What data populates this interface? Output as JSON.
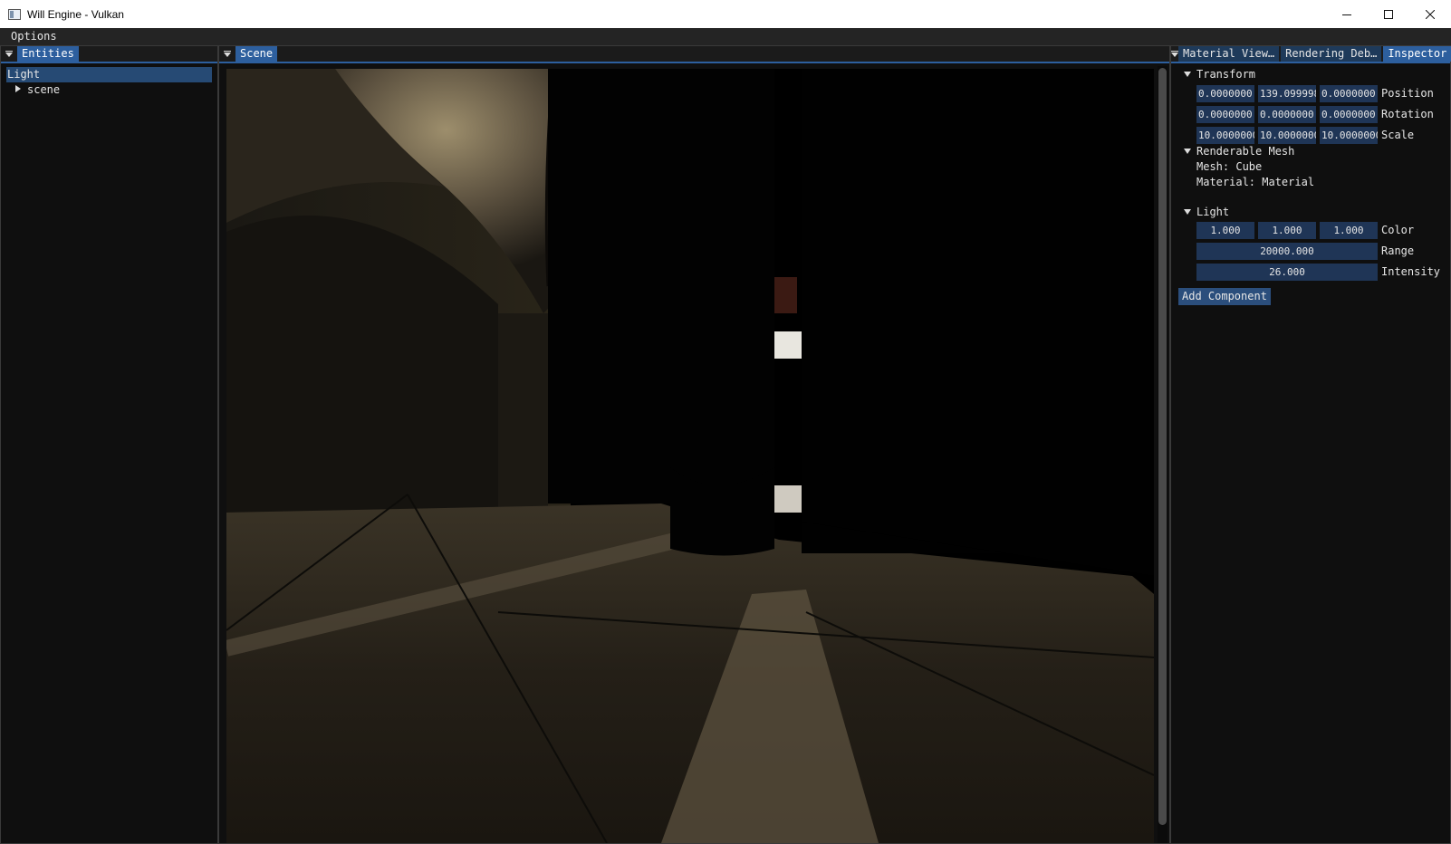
{
  "window": {
    "title": "Will Engine - Vulkan"
  },
  "menu": {
    "options": "Options"
  },
  "entities": {
    "tab": "Entities",
    "items": [
      {
        "label": "Light"
      },
      {
        "label": "scene"
      }
    ]
  },
  "scene": {
    "tab": "Scene"
  },
  "inspector": {
    "tabs": [
      "Material View…",
      "Rendering Deb…",
      "Inspector"
    ],
    "transform": {
      "header": "Transform",
      "position": {
        "label": "Position",
        "values": [
          "0.0000000",
          "139.099998",
          "0.0000000"
        ]
      },
      "rotation": {
        "label": "Rotation",
        "values": [
          "0.0000000",
          "0.0000000",
          "0.0000000"
        ]
      },
      "scale": {
        "label": "Scale",
        "values": [
          "10.0000000",
          "10.0000000",
          "10.0000000"
        ]
      }
    },
    "renderable_mesh": {
      "header": "Renderable Mesh",
      "mesh": "Mesh: Cube",
      "material": "Material: Material"
    },
    "light": {
      "header": "Light",
      "color": {
        "label": "Color",
        "values": [
          "1.000",
          "1.000",
          "1.000"
        ]
      },
      "range": {
        "label": "Range",
        "value": "20000.000"
      },
      "intensity": {
        "label": "Intensity",
        "value": "26.000"
      }
    },
    "add_component": "Add Component"
  }
}
